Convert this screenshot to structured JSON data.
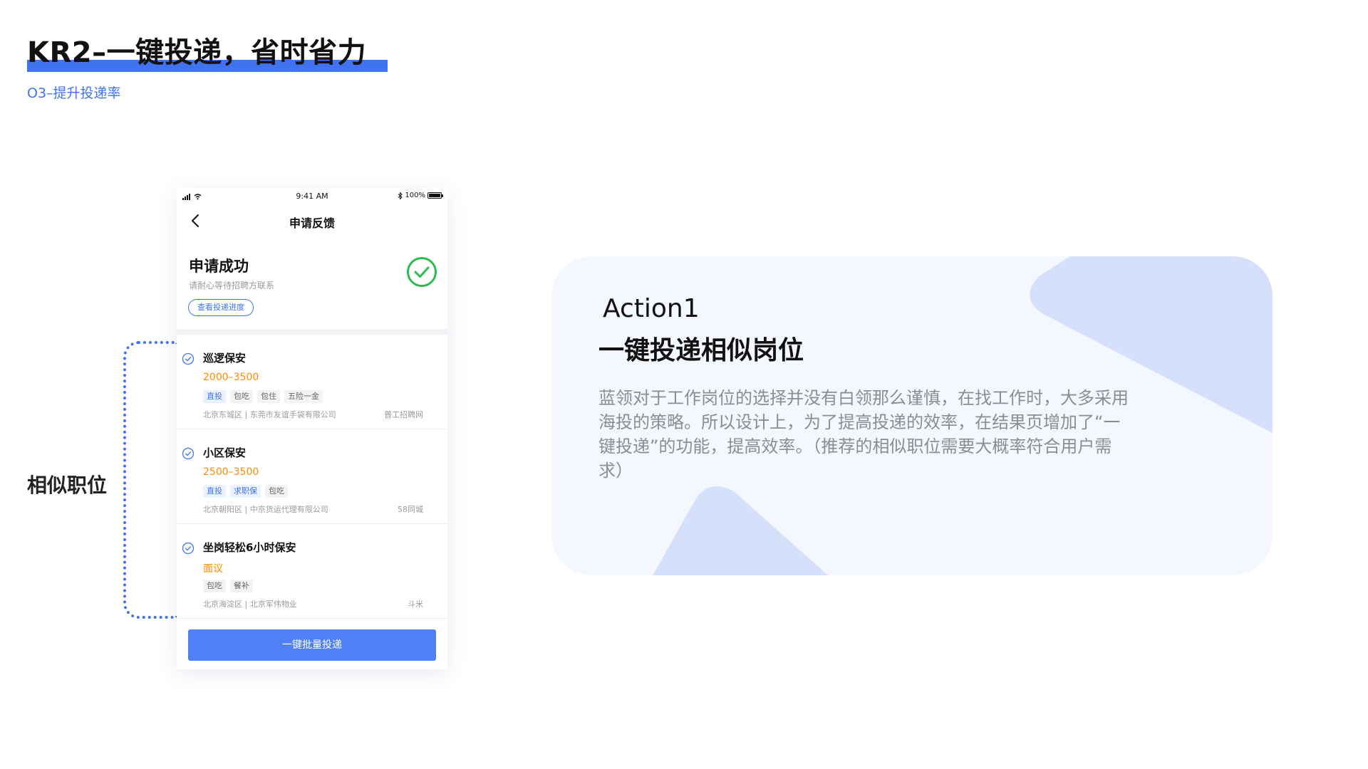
{
  "slide": {
    "title": "KR2–一键投递，省时省力",
    "subtitle": "O3–提升投递率",
    "side_label": "相似职位"
  },
  "colors": {
    "accent": "#3f73f0",
    "button": "#4f80f6",
    "salary": "#ff8a00",
    "success_green": "#2dbd4a",
    "card_background": "#f4f7fd",
    "card_shape": "#d6e0fb"
  },
  "phone": {
    "status_bar": {
      "time": "9:41 AM",
      "battery": "100%",
      "battery_level": 1.0,
      "icons": [
        "signal-icon",
        "wifi-icon",
        "bluetooth-icon",
        "battery-icon"
      ]
    },
    "nav": {
      "title": "申请反馈",
      "back_icon": "back-arrow-icon"
    },
    "success": {
      "title": "申请成功",
      "description": "请耐心等待招聘方联系",
      "progress_button": "查看投递进度",
      "icon": "check-circle-icon"
    },
    "jobs": [
      {
        "title": "巡逻保安",
        "salary": "2000–3500",
        "tags": [
          {
            "text": "直投",
            "style": "blue"
          },
          {
            "text": "包吃",
            "style": "gray"
          },
          {
            "text": "包住",
            "style": "gray"
          },
          {
            "text": "五险一金",
            "style": "gray"
          }
        ],
        "meta": "北京东城区 | 东莞市友谊手袋有限公司",
        "source": "普工招聘网",
        "checked": true
      },
      {
        "title": "小区保安",
        "salary": "2500–3500",
        "tags": [
          {
            "text": "直投",
            "style": "blue"
          },
          {
            "text": "求职保",
            "style": "blue"
          },
          {
            "text": "包吃",
            "style": "gray"
          }
        ],
        "meta": "北京朝阳区 | 中京货运代理有限公司",
        "source": "58同城",
        "checked": true
      },
      {
        "title": "坐岗轻松6小时保安",
        "salary": "面议",
        "tags": [
          {
            "text": "包吃",
            "style": "gray"
          },
          {
            "text": "餐补",
            "style": "gray"
          }
        ],
        "meta": "北京海淀区 | 北京军伟物业",
        "source": "斗米",
        "checked": true
      }
    ],
    "batch_button": "一键批量投递"
  },
  "action_card": {
    "label": "Action1",
    "heading": "一键投递相似岗位",
    "body": "蓝领对于工作岗位的选择并没有白领那么谨慎，在找工作时，大多采用海投的策略。所以设计上，为了提高投递的效率，在结果页增加了“一键投递”的功能，提高效率。（推荐的相似职位需要大概率符合用户需求）"
  }
}
